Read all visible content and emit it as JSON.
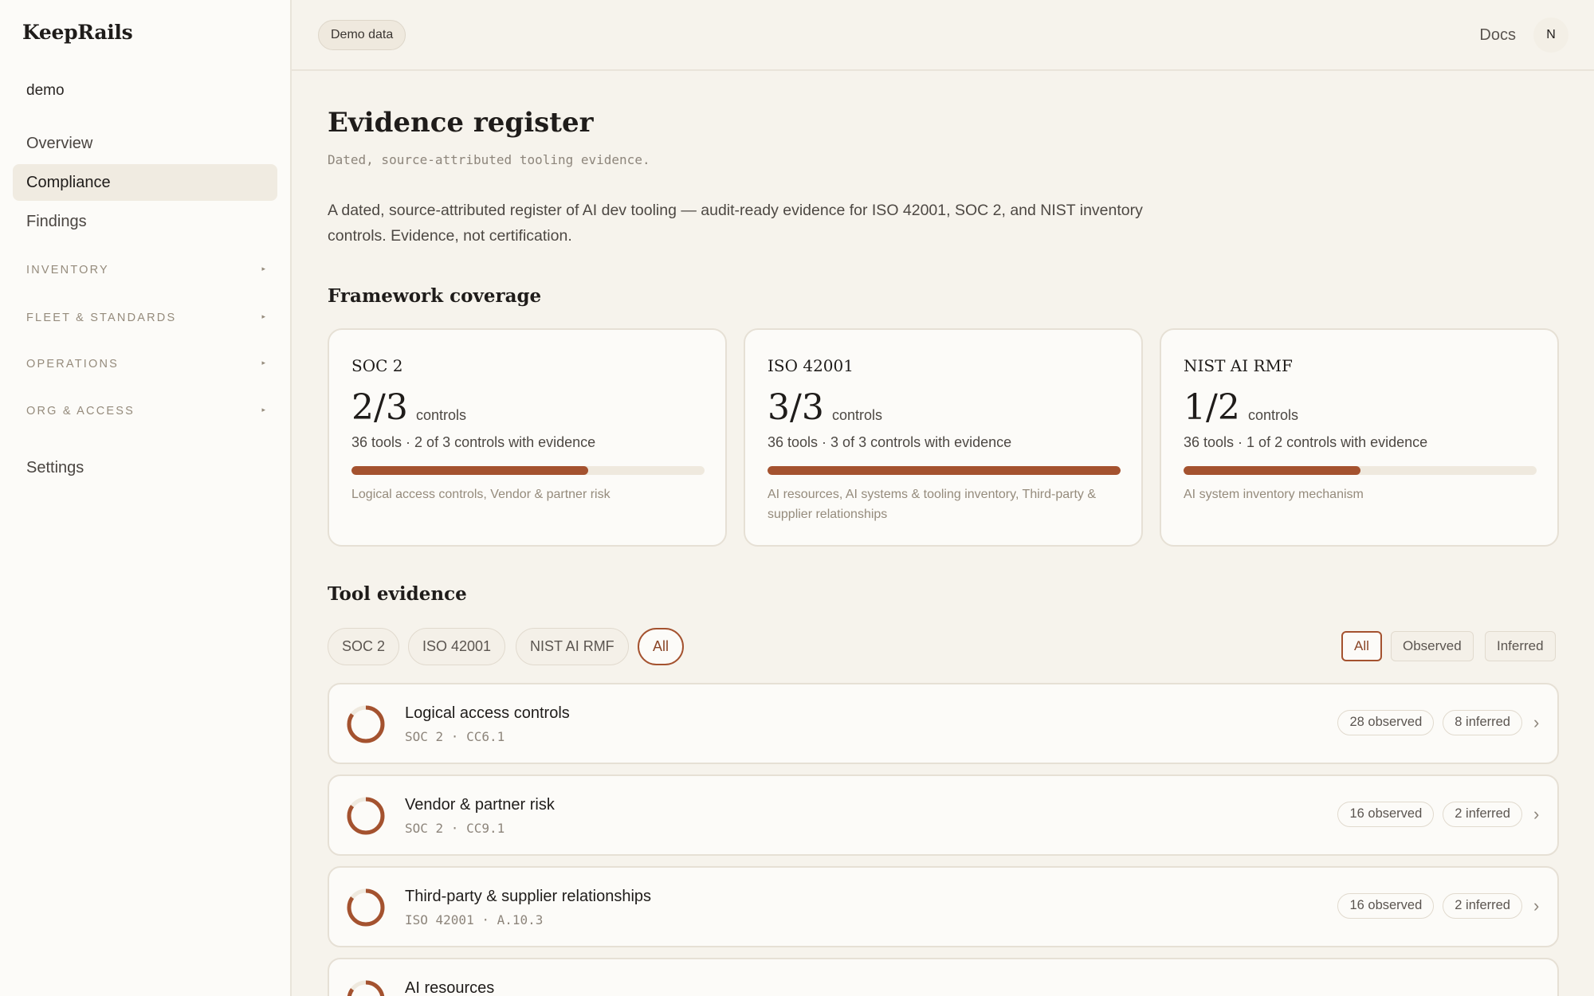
{
  "app": {
    "brand": "KeepRails",
    "workspace": "demo"
  },
  "sidebar": {
    "items": [
      {
        "label": "Overview",
        "active": false
      },
      {
        "label": "Compliance",
        "active": true
      },
      {
        "label": "Findings",
        "active": false
      }
    ],
    "sections": [
      {
        "label": "INVENTORY"
      },
      {
        "label": "FLEET & STANDARDS"
      },
      {
        "label": "OPERATIONS"
      },
      {
        "label": "ORG & ACCESS"
      }
    ],
    "settings_label": "Settings"
  },
  "header": {
    "demo_chip": "Demo data",
    "docs_label": "Docs",
    "avatar_initial": "N"
  },
  "page": {
    "title": "Evidence register",
    "subtitle": "Dated, source-attributed tooling evidence.",
    "description": "A dated, source-attributed register of AI dev tooling — audit-ready evidence for ISO 42001, SOC 2, and NIST inventory controls. Evidence, not certification."
  },
  "coverage": {
    "title": "Framework coverage",
    "cards": [
      {
        "name": "SOC 2",
        "ratio": "2/3",
        "ratio_label": "controls",
        "meta": "36 tools · 2 of 3 controls with evidence",
        "progress": 0.67,
        "controls": "Logical access controls, Vendor & partner risk"
      },
      {
        "name": "ISO 42001",
        "ratio": "3/3",
        "ratio_label": "controls",
        "meta": "36 tools · 3 of 3 controls with evidence",
        "progress": 1.0,
        "controls": "AI resources, AI systems & tooling inventory, Third-party & supplier relationships"
      },
      {
        "name": "NIST AI RMF",
        "ratio": "1/2",
        "ratio_label": "controls",
        "meta": "36 tools · 1 of 2 controls with evidence",
        "progress": 0.5,
        "controls": "AI system inventory mechanism"
      }
    ]
  },
  "evidence": {
    "title": "Tool evidence",
    "framework_filters": [
      {
        "label": "SOC 2",
        "active": false
      },
      {
        "label": "ISO 42001",
        "active": false
      },
      {
        "label": "NIST AI RMF",
        "active": false
      },
      {
        "label": "All",
        "active": true
      }
    ],
    "source_filters": [
      {
        "label": "All",
        "active": true
      },
      {
        "label": "Observed",
        "active": false
      },
      {
        "label": "Inferred",
        "active": false
      }
    ],
    "rows": [
      {
        "title": "Logical access controls",
        "framework": "SOC 2 · CC6.1",
        "observed": "28 observed",
        "inferred": "8 inferred"
      },
      {
        "title": "Vendor & partner risk",
        "framework": "SOC 2 · CC9.1",
        "observed": "16 observed",
        "inferred": "2 inferred"
      },
      {
        "title": "Third-party & supplier relationships",
        "framework": "ISO 42001 · A.10.3",
        "observed": "16 observed",
        "inferred": "2 inferred"
      },
      {
        "title": "AI resources",
        "framework": "",
        "observed": "",
        "inferred": ""
      }
    ]
  },
  "colors": {
    "accent": "#a4522f",
    "background": "#f6f3ec",
    "card": "#fcfbf8"
  }
}
